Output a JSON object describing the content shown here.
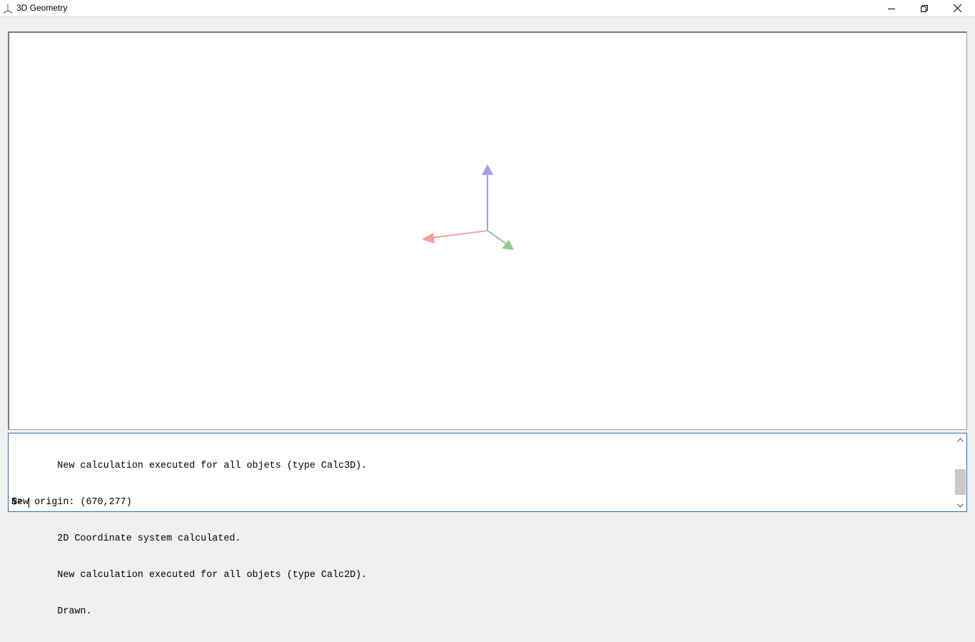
{
  "window": {
    "title": "3D Geometry",
    "app_icon": "axes-icon",
    "controls": {
      "minimize_icon": "minimize-icon",
      "maximize_icon": "restore-icon",
      "close_icon": "close-icon"
    }
  },
  "viewport": {
    "background": "#ffffff",
    "axes": {
      "x_color": "#f4a0a0",
      "y_color": "#90c890",
      "z_color": "#a0a0f0"
    }
  },
  "console": {
    "lines": [
      "        New calculation executed for all objets (type Calc3D).",
      "New origin: (670,277)",
      "        2D Coordinate system calculated.",
      "        New calculation executed for all objets (type Calc2D).",
      "        Drawn."
    ],
    "prompt": "$>",
    "input_value": "",
    "scroll_position": 0.85
  }
}
